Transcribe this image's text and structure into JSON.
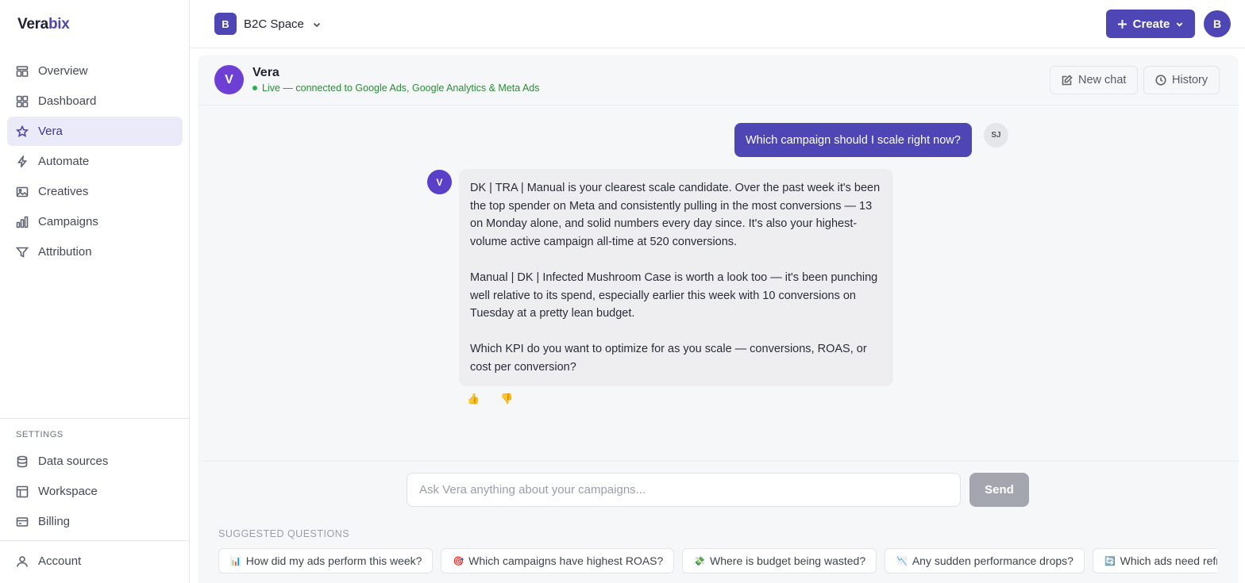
{
  "app": {
    "logo_main": "Vera",
    "logo_accent": "bix",
    "accent_color": "#4f46b5"
  },
  "sidebar": {
    "items": [
      {
        "label": "Overview",
        "icon": "overview-icon"
      },
      {
        "label": "Dashboard",
        "icon": "dashboard-icon"
      },
      {
        "label": "Vera",
        "icon": "star-icon",
        "active": true
      },
      {
        "label": "Automate",
        "icon": "lightning-icon"
      },
      {
        "label": "Creatives",
        "icon": "image-icon"
      },
      {
        "label": "Campaigns",
        "icon": "bar-chart-icon"
      },
      {
        "label": "Attribution",
        "icon": "funnel-icon"
      }
    ],
    "settings_label": "SETTINGS",
    "settings_items": [
      {
        "label": "Data sources",
        "icon": "database-icon"
      },
      {
        "label": "Workspace",
        "icon": "workspace-icon"
      },
      {
        "label": "Billing",
        "icon": "credit-card-icon"
      }
    ],
    "account_label": "Account"
  },
  "topbar": {
    "space_initial": "B",
    "space_name": "B2C Space",
    "create_label": "Create",
    "user_initial": "B"
  },
  "chat": {
    "assistant_initial": "V",
    "assistant_name": "Vera",
    "status": "Live — connected to Google Ads, Google Analytics & Meta Ads",
    "new_chat_label": "New chat",
    "history_label": "History",
    "user_message": "Which campaign should I scale right now?",
    "user_initials": "SJ",
    "bot_initial": "V",
    "bot_paragraphs": [
      "DK | TRA | Manual is your clearest scale candidate. Over the past week it's been the top spender on Meta and consistently pulling in the most conversions — 13 on Monday alone, and solid numbers every day since. It's also your highest-volume active campaign all-time at 520 conversions.",
      "Manual | DK | Infected Mushroom Case is worth a look too — it's been punching well relative to its spend, especially earlier this week with 10 conversions on Tuesday at a pretty lean budget.",
      "Which KPI do you want to optimize for as you scale — conversions, ROAS, or cost per conversion?"
    ],
    "thumbs_up": "👍",
    "thumbs_down": "👎",
    "input_placeholder": "Ask Vera anything about your campaigns...",
    "input_value": "",
    "send_label": "Send"
  },
  "suggestions": {
    "label": "SUGGESTED QUESTIONS",
    "chips": [
      {
        "emoji": "📊",
        "text": "How did my ads perform this week?"
      },
      {
        "emoji": "🎯",
        "text": "Which campaigns have highest ROAS?"
      },
      {
        "emoji": "💸",
        "text": "Where is budget being wasted?"
      },
      {
        "emoji": "📉",
        "text": "Any sudden performance drops?"
      },
      {
        "emoji": "🔄",
        "text": "Which ads need refreshing?"
      }
    ]
  }
}
